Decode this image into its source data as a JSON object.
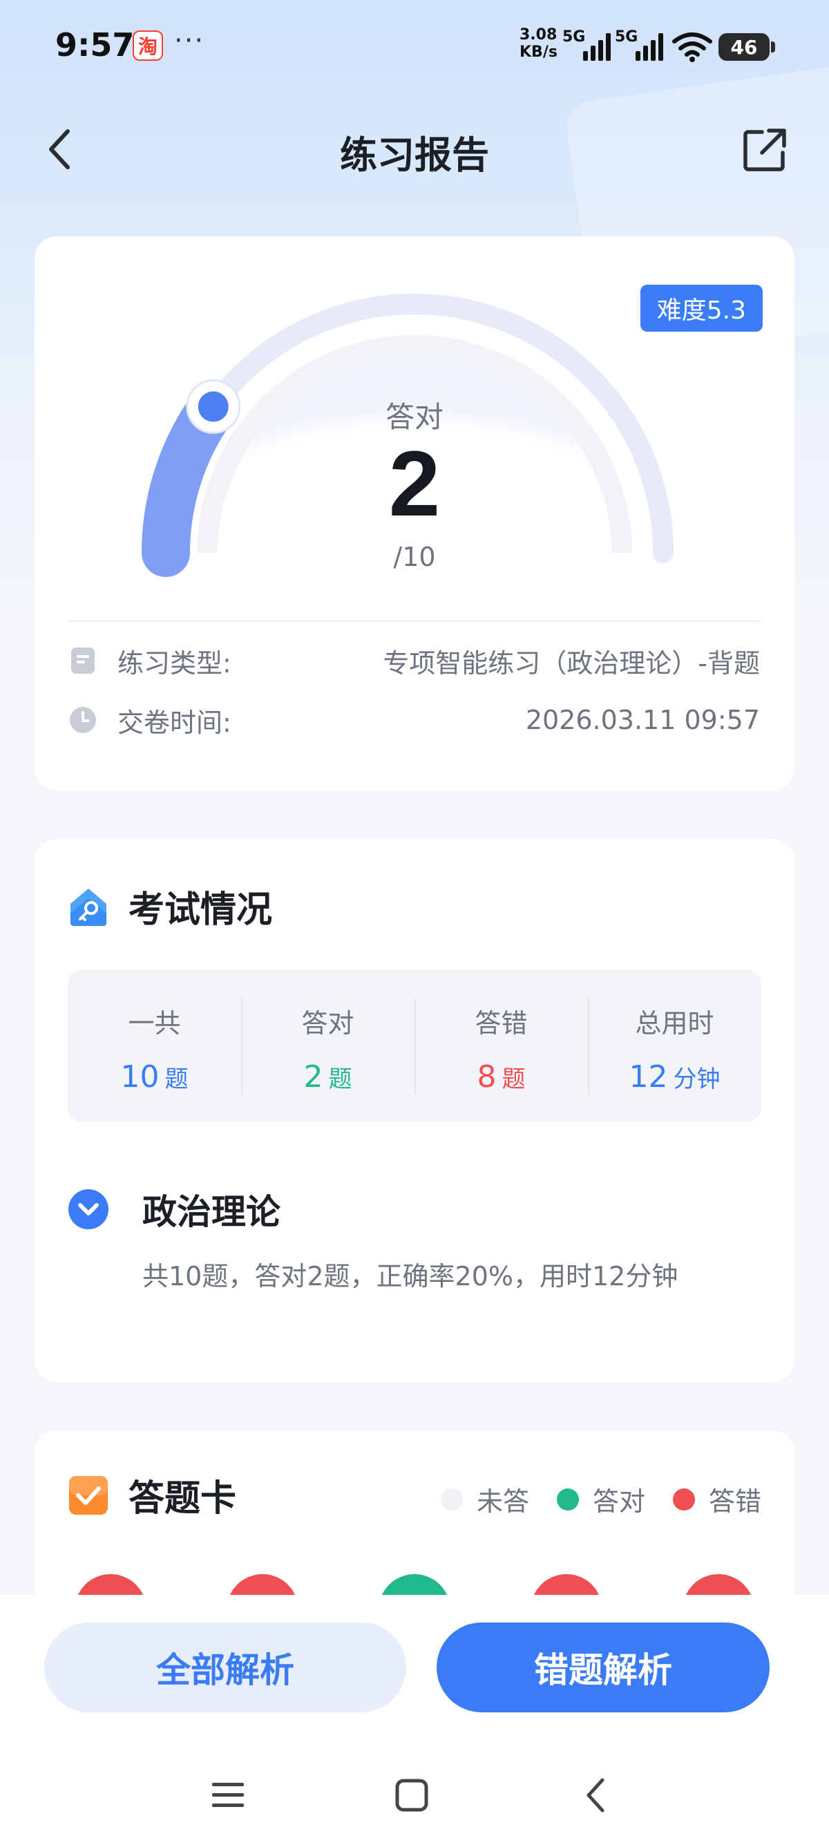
{
  "status_bar": {
    "time": "9:57",
    "app_icon_glyph": "淘",
    "more": "···",
    "speed_value": "3.08",
    "speed_unit": "KB/s",
    "net1": "5G",
    "net2": "5G",
    "battery": "46"
  },
  "header": {
    "title": "练习报告",
    "back_icon": "chevron-left-icon",
    "share_icon": "share-external-icon"
  },
  "score_card": {
    "difficulty": "难度5.3",
    "label": "答对",
    "correct": "2",
    "total": "/10",
    "progress_fraction": 0.2,
    "practice_type_label": "练习类型:",
    "practice_type_value": "专项智能练习（政治理论）-背题",
    "submit_time_label": "交卷时间:",
    "submit_time_value": "2026.03.11 09:57"
  },
  "exam_section": {
    "title": "考试情况",
    "stats": [
      {
        "label": "一共",
        "value": "10",
        "unit": "题"
      },
      {
        "label": "答对",
        "value": "2",
        "unit": "题"
      },
      {
        "label": "答错",
        "value": "8",
        "unit": "题"
      },
      {
        "label": "总用时",
        "value": "12",
        "unit": "分钟"
      }
    ],
    "subject_title": "政治理论",
    "subject_desc": "共10题，答对2题，正确率20%，用时12分钟"
  },
  "answer_card": {
    "title": "答题卡",
    "legend": [
      {
        "label": "未答",
        "color": "#f0f2f6"
      },
      {
        "label": "答对",
        "color": "#22b98a"
      },
      {
        "label": "答错",
        "color": "#f04f52"
      }
    ],
    "answers": [
      "wrong",
      "wrong",
      "correct",
      "wrong",
      "wrong"
    ]
  },
  "bottom": {
    "all_analysis": "全部解析",
    "wrong_analysis": "错题解析"
  },
  "colors": {
    "accent": "#3a7bf6",
    "correct": "#22b98a",
    "wrong": "#f04f52"
  }
}
